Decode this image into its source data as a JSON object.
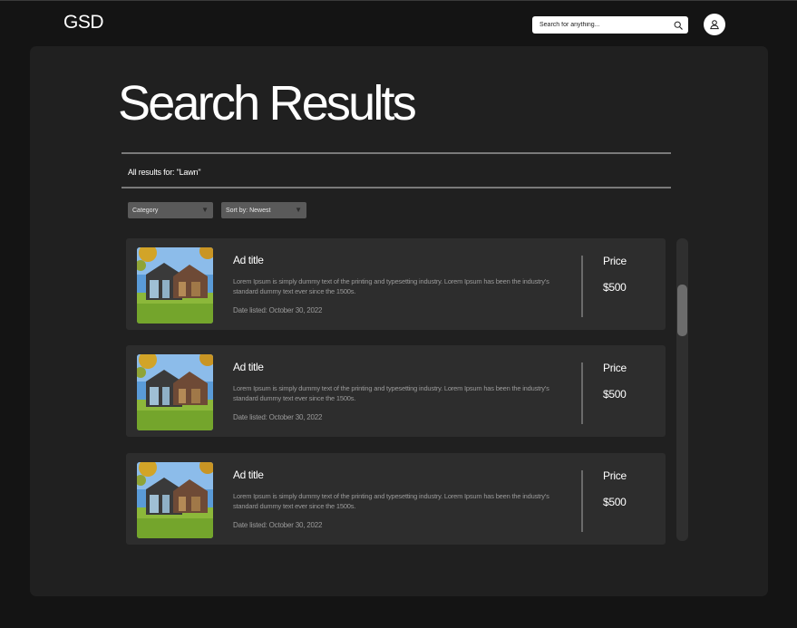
{
  "header": {
    "logo": "GSD",
    "search": {
      "placeholder": "Search for anything...",
      "value": ""
    },
    "search_icon": "search-icon",
    "avatar_icon": "user-icon"
  },
  "main": {
    "title": "Search Results",
    "results_for": "All results for: \"Lawn\"",
    "filters": {
      "category_label": "Category",
      "sort_label": "Sort by: Newest",
      "caret_icon": "caret-down-icon"
    },
    "results": [
      {
        "title": "Ad title",
        "description": "Lorem Ipsum is simply dummy text of the printing and typesetting industry. Lorem Ipsum has been the industry's standard dummy text ever since the 1500s.",
        "date": "Date listed: October 30, 2022",
        "price_label": "Price",
        "price": "$500",
        "image_icon": "house-photo"
      },
      {
        "title": "Ad title",
        "description": "Lorem Ipsum is simply dummy text of the printing and typesetting industry. Lorem Ipsum has been the industry's standard dummy text ever since the 1500s.",
        "date": "Date listed: October 30, 2022",
        "price_label": "Price",
        "price": "$500",
        "image_icon": "house-photo"
      },
      {
        "title": "Ad title",
        "description": "Lorem Ipsum is simply dummy text of the printing and typesetting industry. Lorem Ipsum has been the industry's standard dummy text ever since the 1500s.",
        "date": "Date listed: October 30, 2022",
        "price_label": "Price",
        "price": "$500",
        "image_icon": "house-photo"
      }
    ]
  },
  "colors": {
    "page_background": "#141414",
    "panel_background": "#202020",
    "card_background": "#2d2d2d",
    "dropdown_background": "#5a5a5a",
    "text_primary": "#ffffff",
    "text_secondary": "#9a9a9a"
  }
}
